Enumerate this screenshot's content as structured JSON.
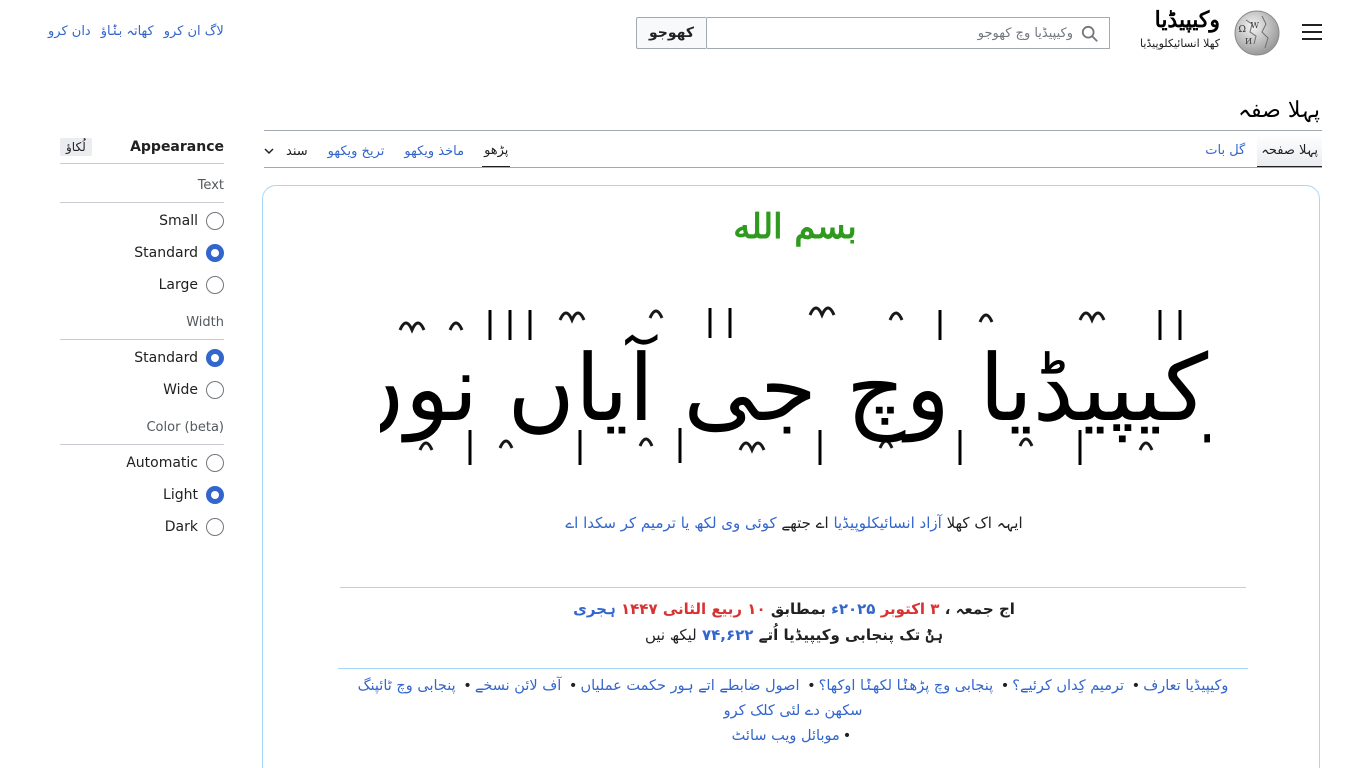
{
  "header": {
    "site_name": "وکیپیڈیا",
    "site_tagline": "کھلا انسائیکلوپیڈیا",
    "search_placeholder": "وکیپیڈیا وچ کھوجو",
    "search_button": "کھوجو",
    "user_links": [
      "دان کرو",
      "کھاتہ بݨاؤ",
      "لاگ ان کرو"
    ]
  },
  "page": {
    "title": "پہلا صفہ",
    "tabs_right": [
      "پہلا صفحہ",
      "گل بات"
    ],
    "tabs_left": [
      "پڑھو",
      "ماخذ ویکھو",
      "تریخ ویکھو",
      "سند"
    ]
  },
  "appearance": {
    "title": "Appearance",
    "hide_label": "لُکاؤ",
    "groups": [
      {
        "title": "Text",
        "options": [
          {
            "label": "Small",
            "checked": false
          },
          {
            "label": "Standard",
            "checked": true
          },
          {
            "label": "Large",
            "checked": false
          }
        ]
      },
      {
        "title": "Width",
        "options": [
          {
            "label": "Standard",
            "checked": true
          },
          {
            "label": "Wide",
            "checked": false
          }
        ]
      },
      {
        "title": "Color (beta)",
        "options": [
          {
            "label": "Automatic",
            "checked": false
          },
          {
            "label": "Light",
            "checked": true
          },
          {
            "label": "Dark",
            "checked": false
          }
        ]
      }
    ]
  },
  "content": {
    "bismillah": "بسم الله",
    "banner": "وکیپیڈیا وچ جی آیاں نوں",
    "tagline": {
      "pre": "ایہہ اک کھلا",
      "link1": "آزاد انسائیکلوپیڈیا",
      "mid": "اے جتھے",
      "link2": "کوئی وی لکھ یا ترمیم کر سکدا اے"
    },
    "dateline": {
      "today": "اج جمعہ ،",
      "day": "۳",
      "month": "اکتوبر",
      "year": "۲۰۲۵ء",
      "equiv": "بمطابق",
      "hday": "۱۰",
      "hmonth": "ربیع الثانی",
      "hyear": "۱۴۴۷",
      "hera": "ہجری",
      "line2_pre": "ہݨ تک پنجابی وکیپیڈیا اُتے",
      "count": "۷۴,۶۲۲",
      "line2_post": "لیکھ نیں"
    },
    "quick_links": [
      "وکیپیڈیا تعارف",
      "ترمیم کِداں کرئیے؟",
      "پنجابی وچ پڑھݨا لکھݨا اوکھا؟",
      "اصول ضابطے اتے ہور حکمت عملیاں",
      "آف لائن نسخے",
      "پنجابی وچ ٹائپنگ سکھن دے لئی کلک کرو",
      "موبائل ویب سائٹ"
    ]
  }
}
